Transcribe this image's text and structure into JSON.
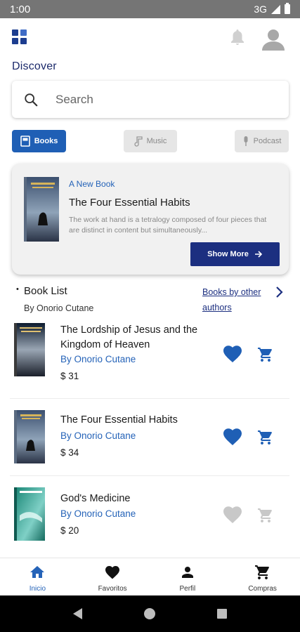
{
  "status_bar": {
    "time": "1:00",
    "network": "3G"
  },
  "header": {
    "section_title": "Discover"
  },
  "search": {
    "placeholder": "Search",
    "value": ""
  },
  "categories": [
    {
      "label": "Books",
      "icon": "book-icon",
      "active": true
    },
    {
      "label": "Music",
      "icon": "music-note-icon",
      "active": false
    },
    {
      "label": "Podcast",
      "icon": "microphone-icon",
      "active": false
    }
  ],
  "featured": {
    "tag": "A New Book",
    "title": "The Four Essential Habits",
    "description": "The work at hand is a tetralogy composed of four pieces that are distinct in content but simultaneously...",
    "button_label": "Show More"
  },
  "book_list": {
    "title": "Book List",
    "subtitle": "By Onorio Cutane",
    "other_link": "Books by other authors"
  },
  "books": [
    {
      "title": "The Lordship of Jesus and the Kingdom of Heaven",
      "author": "By Onorio Cutane",
      "price": "$ 31",
      "favorite": true,
      "in_cart": true
    },
    {
      "title": "The Four Essential Habits",
      "author": "By Onorio Cutane",
      "price": "$ 34",
      "favorite": true,
      "in_cart": true
    },
    {
      "title": "God's Medicine",
      "author": "By Onorio Cutane",
      "price": "$ 20",
      "favorite": false,
      "in_cart": false
    }
  ],
  "bottom_nav": [
    {
      "label": "Inicio",
      "icon": "home-icon",
      "active": true
    },
    {
      "label": "Favoritos",
      "icon": "heart-icon",
      "active": false
    },
    {
      "label": "Perfil",
      "icon": "person-icon",
      "active": false
    },
    {
      "label": "Compras",
      "icon": "cart-icon",
      "active": false
    }
  ],
  "colors": {
    "primary": "#1f5fb5",
    "dark_navy": "#1c2f80",
    "link_blue": "#2563b8",
    "inactive_icon": "#c8c8c8"
  }
}
